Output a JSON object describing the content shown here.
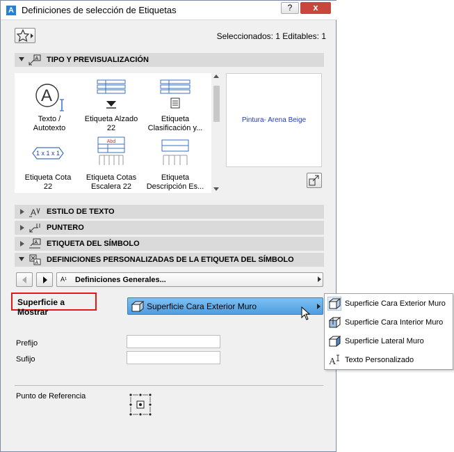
{
  "window": {
    "title": "Definiciones de selección de Etiquetas",
    "help_label": "?",
    "close_label": "x"
  },
  "header": {
    "selection_info": "Seleccionados: 1 Editables: 1"
  },
  "sections": {
    "tipo": "TIPO Y PREVISUALIZACIÓN",
    "estilo": "ESTILO DE TEXTO",
    "puntero": "PUNTERO",
    "etiqueta_simbolo": "ETIQUETA DEL SÍMBOLO",
    "definiciones": "DEFINICIONES PERSONALIZADAS DE LA ETIQUETA DEL SÍMBOLO"
  },
  "gallery": {
    "items": [
      {
        "label": "Texto /\nAutotexto",
        "icon": "autotext-icon"
      },
      {
        "label": "Etiqueta Alzado\n22",
        "icon": "elevation-label-icon"
      },
      {
        "label": "Etiqueta\nClasificación y...",
        "icon": "classification-label-icon"
      },
      {
        "label": "Etiqueta Cota\n22",
        "icon": "dimension-label-icon"
      },
      {
        "label": "Etiqueta Cotas\nEscalera 22",
        "icon": "stair-dimension-label-icon"
      },
      {
        "label": "Etiqueta\nDescripción Es...",
        "icon": "description-label-icon"
      }
    ],
    "dimension_icon_text": "1 x 1 x 1",
    "stair_icon_text": "Abd"
  },
  "preview": {
    "text": "Pintura- Arena Beige"
  },
  "definitions_nav": {
    "dropdown_label": "Definiciones Generales...",
    "icon_text": "A¹"
  },
  "surface": {
    "label": "Superficie a Mostrar",
    "selected": "Superficie Cara Exterior Muro",
    "options": [
      {
        "label": "Superficie Cara Exterior Muro",
        "icon": "wall-exterior-face-icon"
      },
      {
        "label": "Superficie Cara Interior Muro",
        "icon": "wall-interior-face-icon"
      },
      {
        "label": "Superficie Lateral Muro",
        "icon": "wall-side-face-icon"
      },
      {
        "label": "Texto Personalizado",
        "icon": "custom-text-icon"
      }
    ]
  },
  "fields": {
    "prefijo": {
      "label": "Prefijo",
      "value": ""
    },
    "sufijo": {
      "label": "Sufijo",
      "value": ""
    },
    "referencia": {
      "label": "Punto de Referencia"
    }
  }
}
